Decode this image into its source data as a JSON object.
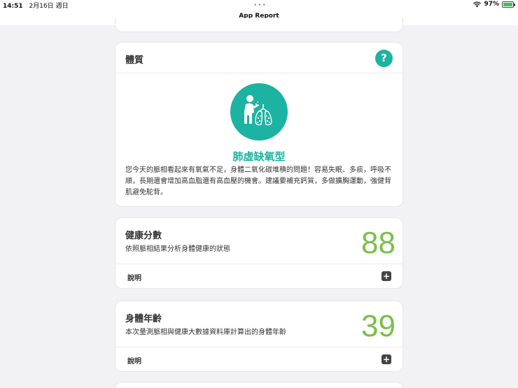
{
  "status_bar": {
    "time": "14:51",
    "date": "2月16日 週日",
    "wifi_icon": "wifi-icon",
    "battery_percent": "97%",
    "battery_level": 0.97
  },
  "nav": {
    "title": "App Report",
    "more_icon": "ellipsis-icon"
  },
  "constitution_card": {
    "title": "體質",
    "help_label": "?",
    "illustration_icon": "lung-figure-icon",
    "type_title": "肺虛缺氧型",
    "description": "您今天的脈相看起來有氧氣不足，身體二氧化碳堆積的問題！容易失眠、多痰，呼吸不順，長期還會增加高血脂還有高血壓的機會。建議要補充鈣質，多做擴胸運動，強健背肌避免駝背。"
  },
  "health_score_card": {
    "title": "健康分數",
    "subtitle": "依照脈相結果分析身體健康的狀態",
    "value": "88",
    "explain_label": "說明",
    "expand_label": "+"
  },
  "body_age_card": {
    "title": "身體年齡",
    "subtitle": "本次量測脈相與健康大數據資料庫計算出的身體年齡",
    "value": "39",
    "explain_label": "說明",
    "expand_label": "+"
  },
  "colors": {
    "accent_teal": "#1cb3a2",
    "score_green": "#7bbf49"
  }
}
